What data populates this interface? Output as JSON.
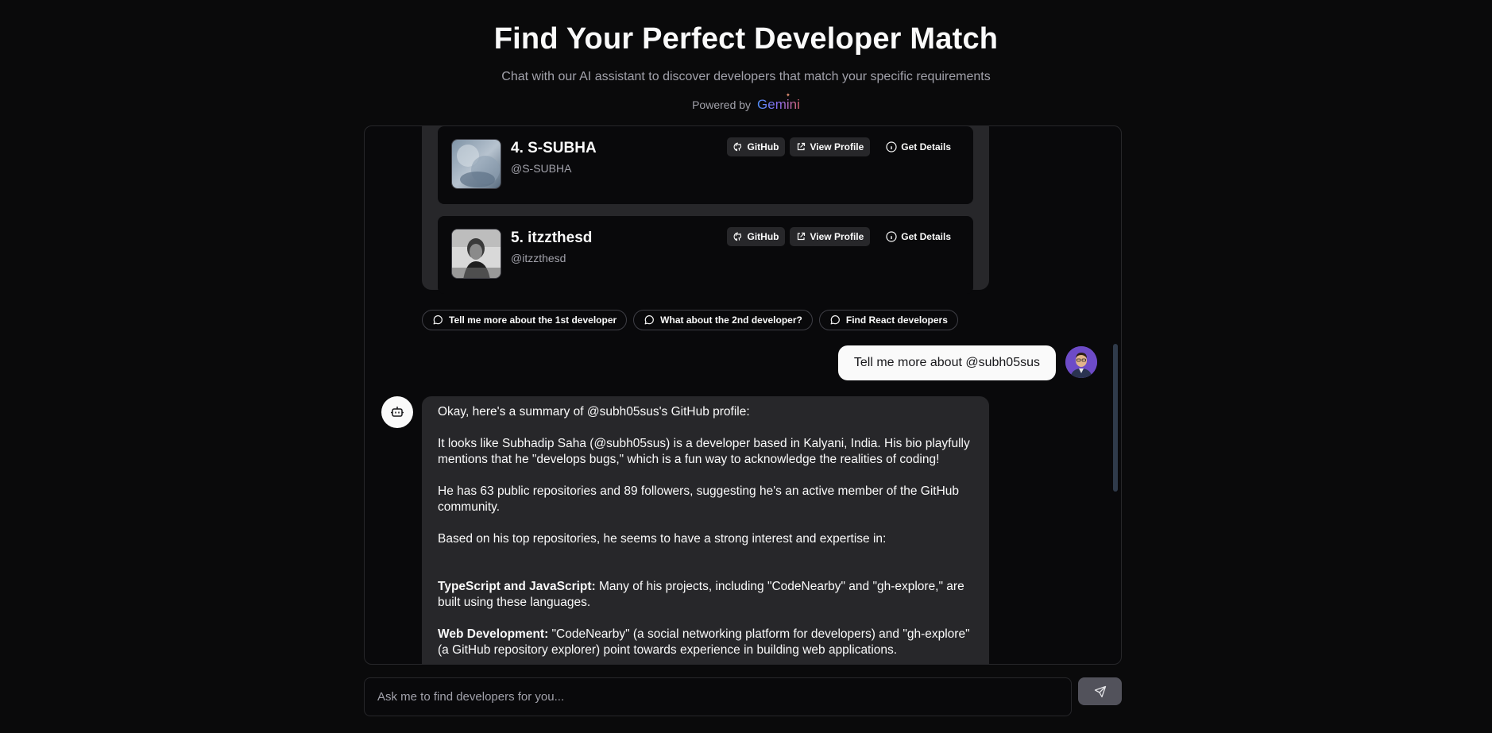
{
  "hero": {
    "title": "Find Your Perfect Developer Match",
    "subtitle": "Chat with our AI assistant to discover developers that match your specific requirements",
    "powered_by": "Powered by",
    "brand": "Gemini"
  },
  "results": {
    "developers": [
      {
        "name": "4. S-SUBHA",
        "handle": "@S-SUBHA",
        "github_label": "GitHub",
        "view_label": "View Profile",
        "details_label": "Get Details"
      },
      {
        "name": "5. itzzthesd",
        "handle": "@itzzthesd",
        "github_label": "GitHub",
        "view_label": "View Profile",
        "details_label": "Get Details"
      }
    ]
  },
  "suggestions": [
    "Tell me more about the 1st developer",
    "What about the 2nd developer?",
    "Find React developers"
  ],
  "user_message": "Tell me more about @subh05sus",
  "bot_message": {
    "intro": "Okay, here's a summary of @subh05sus's GitHub profile:",
    "p1": "It looks like Subhadip Saha (@subh05sus) is a developer based in Kalyani, India. His bio playfully mentions that he \"develops bugs,\" which is a fun way to acknowledge the realities of coding!",
    "p2": "He has 63 public repositories and 89 followers, suggesting he's an active member of the GitHub community.",
    "p3": "Based on his top repositories, he seems to have a strong interest and expertise in:",
    "item1_title": "TypeScript and JavaScript:",
    "item1_text": " Many of his projects, including \"CodeNearby\" and \"gh-explore,\" are built using these languages.",
    "item2_title": "Web Development:",
    "item2_text": " \"CodeNearby\" (a social networking platform for developers) and \"gh-explore\" (a GitHub repository explorer) point towards experience in building web applications."
  },
  "composer": {
    "placeholder": "Ask me to find developers for you..."
  },
  "colors": {
    "background": "#0a0a0b",
    "card": "#27272a",
    "accent_user_avatar": "#6d4bc7"
  }
}
